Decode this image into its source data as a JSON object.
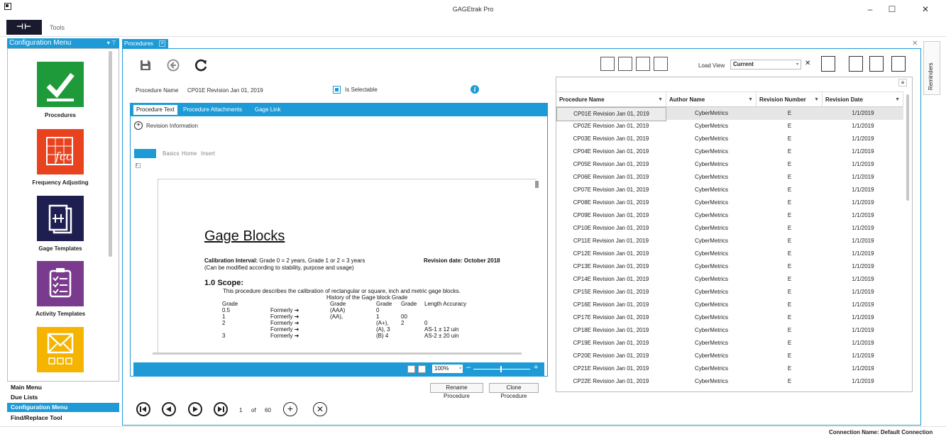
{
  "window": {
    "title": "GAGEtrak Pro",
    "logo_text": "⊣⊢",
    "tools_label": "Tools",
    "minimize": "–",
    "maximize": "☐",
    "close": "✕"
  },
  "sidebar": {
    "header": "Configuration Menu",
    "header_pins": "▾ ⊤",
    "tiles": [
      {
        "label": "Procedures",
        "color": "#1f9a3a",
        "icon": "checkmark-icon"
      },
      {
        "label": "Frequency Adjusting",
        "color": "#e8431e",
        "icon": "frequency-chart-icon"
      },
      {
        "label": "Gage Templates",
        "color": "#1e1e50",
        "icon": "gage-template-icon"
      },
      {
        "label": "Activity Templates",
        "color": "#7a3b8e",
        "icon": "clipboard-icon"
      },
      {
        "label": "",
        "color": "#f4b400",
        "icon": "envelope-icon"
      }
    ],
    "nav": [
      "Main Menu",
      "Due Lists",
      "Configuration Menu",
      "Find/Replace Tool"
    ],
    "active_nav": "Configuration Menu"
  },
  "tab": {
    "label": "Procedures",
    "close": "✕"
  },
  "panel_close": "✕",
  "reminders_label": "Reminders",
  "form": {
    "proc_name_label": "Procedure Name",
    "proc_name_value": "CP01E Revision Jan 01, 2019",
    "selectable_label": "Is Selectable",
    "info": "i"
  },
  "subtabs": [
    "Procedure Text",
    "Procedure Attachments",
    "Gage Link"
  ],
  "editor": {
    "rev_info_label": "Revision Information",
    "rev_info_icon": "+",
    "ribbon_tabs": [
      "Basics",
      "Home",
      "Insert"
    ],
    "ruler_marker": "L",
    "zoom": "100%",
    "zoom_arrow": "▾",
    "zoom_minus": "–",
    "zoom_plus": "+"
  },
  "document": {
    "title": "Gage Blocks",
    "calib_bold": "Calibration Interval:",
    "calib_text": " Grade 0 = 2 years, Grade 1 or 2 = 3 years",
    "revision_date": "Revision date: October 2018",
    "modified_note": "(Can be modified according to stability, purpose and usage)",
    "scope_heading": "1.0   Scope:",
    "scope_text": "This procedure describes the calibration of rectangular or square, inch and metric gage blocks.",
    "history_title": "History of the Gage block Grade",
    "grade_col_a": [
      "Grade",
      "0.5",
      "1",
      "2",
      "",
      "3"
    ],
    "formerly_col": [
      "",
      "Formerly ➔",
      "Formerly ➔",
      "Formerly ➔",
      "Formerly ➔",
      "Formerly ➔"
    ],
    "grade_col_b": [
      "Grade",
      "(AAA)",
      "(AA),",
      "",
      "",
      ""
    ],
    "grade_col_c": [
      "Grade",
      "0",
      "1",
      "(A+),",
      "(A),  3",
      "(B)  4"
    ],
    "grade_col_d": [
      "Grade",
      "",
      "00",
      "2",
      "",
      ""
    ],
    "grade_col_e": [
      "Length Accuracy",
      "",
      "",
      "0",
      "AS-1    ± 12 uin",
      "AS-2    ± 20 uin"
    ]
  },
  "actions": {
    "rename": "Rename Procedure",
    "clone": "Clone Procedure"
  },
  "pager": {
    "current": "1",
    "of_label": "of",
    "total": "60",
    "add": "+",
    "delete": "✕"
  },
  "grid_toolbar": {
    "load_view_label": "Load View",
    "load_view_value": "Current",
    "load_view_arrow": "▾",
    "clear": "✕",
    "menu_icon": "≡"
  },
  "grid": {
    "columns": [
      "Procedure Name",
      "Author Name",
      "Revision Number",
      "Revision Date"
    ],
    "filter_icon": "▼",
    "rows": [
      [
        "CP01E Revision Jan 01, 2019",
        "CyberMetrics",
        "E",
        "1/1/2019"
      ],
      [
        "CP02E Revision Jan 01, 2019",
        "CyberMetrics",
        "E",
        "1/1/2019"
      ],
      [
        "CP03E Revision Jan 01, 2019",
        "CyberMetrics",
        "E",
        "1/1/2019"
      ],
      [
        "CP04E Revision Jan 01, 2019",
        "CyberMetrics",
        "E",
        "1/1/2019"
      ],
      [
        "CP05E Revision Jan 01, 2019",
        "CyberMetrics",
        "E",
        "1/1/2019"
      ],
      [
        "CP06E Revision Jan 01, 2019",
        "CyberMetrics",
        "E",
        "1/1/2019"
      ],
      [
        "CP07E Revision Jan 01, 2019",
        "CyberMetrics",
        "E",
        "1/1/2019"
      ],
      [
        "CP08E Revision Jan 01, 2019",
        "CyberMetrics",
        "E",
        "1/1/2019"
      ],
      [
        "CP09E Revision Jan 01, 2019",
        "CyberMetrics",
        "E",
        "1/1/2019"
      ],
      [
        "CP10E Revision Jan 01, 2019",
        "CyberMetrics",
        "E",
        "1/1/2019"
      ],
      [
        "CP11E Revision Jan 01, 2019",
        "CyberMetrics",
        "E",
        "1/1/2019"
      ],
      [
        "CP12E Revision Jan 01, 2019",
        "CyberMetrics",
        "E",
        "1/1/2019"
      ],
      [
        "CP13E Revision Jan 01, 2019",
        "CyberMetrics",
        "E",
        "1/1/2019"
      ],
      [
        "CP14E Revision Jan 01, 2019",
        "CyberMetrics",
        "E",
        "1/1/2019"
      ],
      [
        "CP15E Revision Jan 01, 2019",
        "CyberMetrics",
        "E",
        "1/1/2019"
      ],
      [
        "CP16E Revision Jan 01, 2019",
        "CyberMetrics",
        "E",
        "1/1/2019"
      ],
      [
        "CP17E Revision Jan 01, 2019",
        "CyberMetrics",
        "E",
        "1/1/2019"
      ],
      [
        "CP18E Revision Jan 01, 2019",
        "CyberMetrics",
        "E",
        "1/1/2019"
      ],
      [
        "CP19E Revision Jan 01, 2019",
        "CyberMetrics",
        "E",
        "1/1/2019"
      ],
      [
        "CP20E Revision Jan 01, 2019",
        "CyberMetrics",
        "E",
        "1/1/2019"
      ],
      [
        "CP21E Revision Jan 01, 2019",
        "CyberMetrics",
        "E",
        "1/1/2019"
      ],
      [
        "CP22E Revision Jan 01, 2019",
        "CyberMetrics",
        "E",
        "1/1/2019"
      ]
    ],
    "selected_row": 0
  },
  "status": {
    "connection": "Connection Name: Default Connection"
  },
  "colors": {
    "accent": "#1e9bd7"
  }
}
